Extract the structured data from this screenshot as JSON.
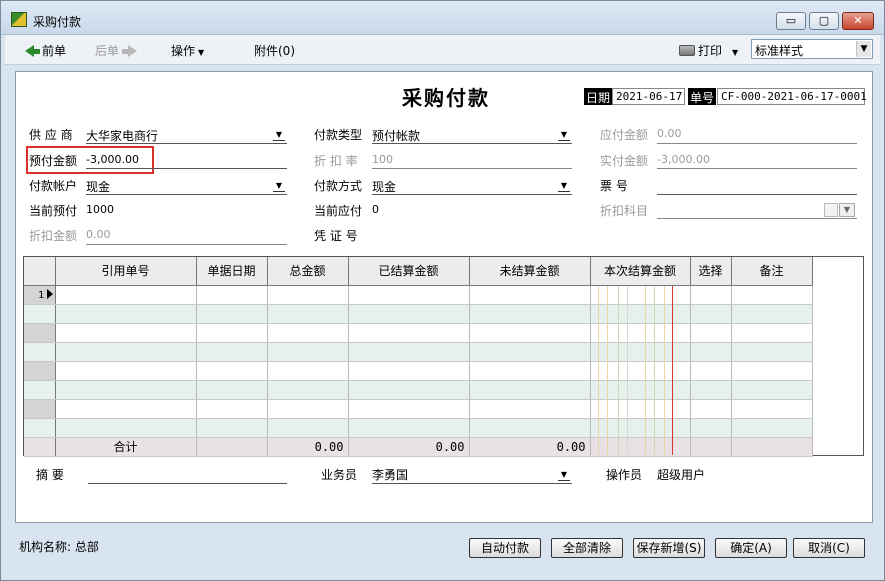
{
  "window": {
    "title": "采购付款",
    "min_glyph": "▭",
    "max_glyph": "▢",
    "close_glyph": "✕"
  },
  "toolbar": {
    "prev_label": "前单",
    "next_label": "后单",
    "ops_label": "操作",
    "attach_label": "附件(0)",
    "print_label": "打印",
    "style_value": "标准样式"
  },
  "form": {
    "title": "采购付款",
    "date_label": "日期",
    "date_value": "2021-06-17",
    "bill_no_label": "单号",
    "bill_no_value": "CF-000-2021-06-17-0001"
  },
  "fields": {
    "supplier_label": "供 应 商",
    "supplier_value": "大华家电商行",
    "prepay_label": "预付金额",
    "prepay_value": "-3,000.00",
    "pay_account_label": "付款帐户",
    "pay_account_value": "现金",
    "current_prepay_label": "当前预付",
    "current_prepay_value": "1000",
    "discount_amount_label": "折扣金额",
    "discount_amount_value": "0.00",
    "pay_type_label": "付款类型",
    "pay_type_value": "预付帐款",
    "discount_rate_label": "折 扣 率",
    "discount_rate_value": "100",
    "pay_method_label": "付款方式",
    "pay_method_value": "现金",
    "current_payable_label": "当前应付",
    "current_payable_value": "0",
    "voucher_label": "凭 证 号",
    "payable_label": "应付金额",
    "payable_value": "0.00",
    "actual_pay_label": "实付金额",
    "actual_pay_value": "-3,000.00",
    "ticket_no_label": "票    号",
    "discount_subject_label": "折扣科目"
  },
  "grid": {
    "columns": [
      "引用单号",
      "单据日期",
      "总金额",
      "已结算金额",
      "未结算金额",
      "本次结算金额",
      "选择",
      "备注"
    ],
    "first_row_number": "1",
    "sum_label": "合计",
    "sum_total": "0.00",
    "sum_settled": "0.00",
    "sum_unsettled": "0.00"
  },
  "footer_fields": {
    "summary_label": "摘    要",
    "salesman_label": "业务员",
    "salesman_value": "李勇国",
    "operator_label": "操作员",
    "operator_value": "超级用户"
  },
  "status": {
    "org_label": "机构名称: 总部"
  },
  "buttons": {
    "auto_pay": "自动付款",
    "clear_all": "全部清除",
    "save_new": "保存新增(S)",
    "ok": "确定(A)",
    "cancel": "取消(C)"
  },
  "colors": {
    "highlight_border": "#d9302a",
    "grid_alt_row": "#e6f0ec",
    "grid_sum_row": "#e8e2e4",
    "accent_arrow": "#2a8a2a"
  }
}
